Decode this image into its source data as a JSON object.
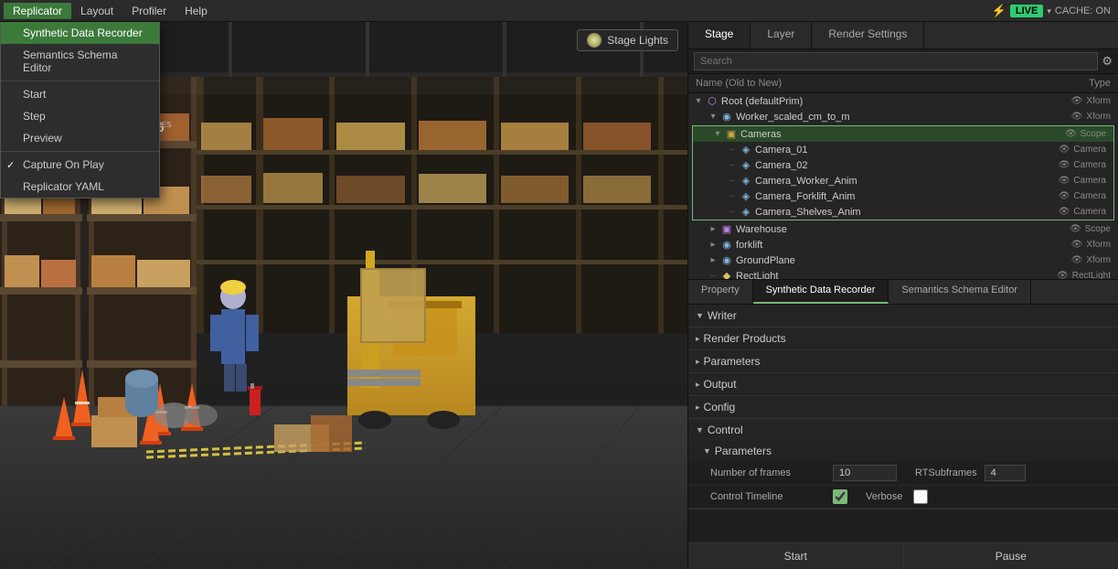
{
  "menuBar": {
    "items": [
      "Replicator",
      "Layout",
      "Profiler",
      "Help"
    ],
    "activeItem": "Replicator"
  },
  "statusBar": {
    "liveLabel": "LIVE",
    "dropdownArrow": "▾",
    "cacheLabel": "CACHE: ON"
  },
  "dropdown": {
    "items": [
      {
        "id": "synthetic-data-recorder",
        "label": "Synthetic Data Recorder",
        "highlighted": true,
        "checked": false
      },
      {
        "id": "semantics-schema-editor",
        "label": "Semantics Schema Editor",
        "highlighted": false,
        "checked": false
      },
      {
        "id": "sep1",
        "type": "divider"
      },
      {
        "id": "start",
        "label": "Start",
        "highlighted": false,
        "checked": false
      },
      {
        "id": "step",
        "label": "Step",
        "highlighted": false,
        "checked": false
      },
      {
        "id": "preview",
        "label": "Preview",
        "highlighted": false,
        "checked": false
      },
      {
        "id": "sep2",
        "type": "divider"
      },
      {
        "id": "capture-on-play",
        "label": "Capture On Play",
        "highlighted": false,
        "checked": true
      },
      {
        "id": "replicator-yaml",
        "label": "Replicator YAML",
        "highlighted": false,
        "checked": false
      }
    ]
  },
  "viewport": {
    "stageLightsLabel": "Stage Lights"
  },
  "rightPanel": {
    "topTabs": [
      "Stage",
      "Layer",
      "Render Settings"
    ],
    "activeTopTab": "Stage",
    "searchPlaceholder": "Search",
    "treeHeader": {
      "nameCol": "Name (Old to New)",
      "typeCol": "Type"
    },
    "treeItems": [
      {
        "id": "root",
        "level": 0,
        "expand": "▾",
        "icon": "👤",
        "iconClass": "icon-person",
        "label": "Root (defaultPrim)",
        "type": "Xform",
        "eye": true
      },
      {
        "id": "worker",
        "level": 1,
        "expand": "▾",
        "icon": "👤",
        "iconClass": "icon-person",
        "label": "Worker_scaled_cm_to_m",
        "type": "Xform",
        "eye": true
      },
      {
        "id": "cameras",
        "level": 1,
        "expand": "▾",
        "icon": "📁",
        "iconClass": "icon-folder",
        "label": "Cameras",
        "type": "Scope",
        "eye": true,
        "selected": true
      },
      {
        "id": "camera01",
        "level": 2,
        "expand": " ",
        "icon": "📷",
        "iconClass": "icon-camera",
        "label": "Camera_01",
        "type": "Camera",
        "eye": true
      },
      {
        "id": "camera02",
        "level": 2,
        "expand": " ",
        "icon": "📷",
        "iconClass": "icon-camera",
        "label": "Camera_02",
        "type": "Camera",
        "eye": true
      },
      {
        "id": "camera_worker",
        "level": 2,
        "expand": " ",
        "icon": "📷",
        "iconClass": "icon-camera",
        "label": "Camera_Worker_Anim",
        "type": "Camera",
        "eye": true
      },
      {
        "id": "camera_forklift",
        "level": 2,
        "expand": " ",
        "icon": "📷",
        "iconClass": "icon-camera",
        "label": "Camera_Forklift_Anim",
        "type": "Camera",
        "eye": true
      },
      {
        "id": "camera_shelves",
        "level": 2,
        "expand": " ",
        "icon": "📷",
        "iconClass": "icon-camera",
        "label": "Camera_Shelves_Anim",
        "type": "Camera",
        "eye": true
      },
      {
        "id": "warehouse",
        "level": 1,
        "expand": "▸",
        "icon": "📦",
        "iconClass": "icon-box",
        "label": "Warehouse",
        "type": "Scope",
        "eye": true
      },
      {
        "id": "forklift",
        "level": 1,
        "expand": "▸",
        "icon": "👤",
        "iconClass": "icon-person",
        "label": "forklift",
        "type": "Xform",
        "eye": true
      },
      {
        "id": "groundplane",
        "level": 1,
        "expand": "▸",
        "icon": "👤",
        "iconClass": "icon-person",
        "label": "GroundPlane",
        "type": "Xform",
        "eye": true
      },
      {
        "id": "rectlight",
        "level": 1,
        "expand": " ",
        "icon": "💡",
        "iconClass": "icon-light",
        "label": "RectLight",
        "type": "RectLight",
        "eye": true
      }
    ],
    "bottomTabs": [
      "Property",
      "Synthetic Data Recorder",
      "Semantics Schema Editor"
    ],
    "activeBottomTab": "Synthetic Data Recorder",
    "properties": {
      "sections": [
        {
          "id": "writer",
          "title": "Writer",
          "expanded": true,
          "subsections": []
        },
        {
          "id": "render-products",
          "title": "Render Products",
          "expanded": false
        },
        {
          "id": "parameters",
          "title": "Parameters",
          "expanded": false
        },
        {
          "id": "output",
          "title": "Output",
          "expanded": false
        },
        {
          "id": "config",
          "title": "Config",
          "expanded": false
        },
        {
          "id": "control",
          "title": "Control",
          "expanded": true
        }
      ],
      "controlParams": {
        "subLabel": "Parameters",
        "numFramesLabel": "Number of frames",
        "numFramesValue": "10",
        "rtSubframesLabel": "RTSubframes",
        "rtSubframesValue": "4",
        "controlTimelineLabel": "Control Timeline",
        "controlTimelineChecked": true,
        "verboseLabel": "Verbose",
        "verboseChecked": false
      },
      "buttons": {
        "startLabel": "Start",
        "pauseLabel": "Pause"
      }
    }
  }
}
